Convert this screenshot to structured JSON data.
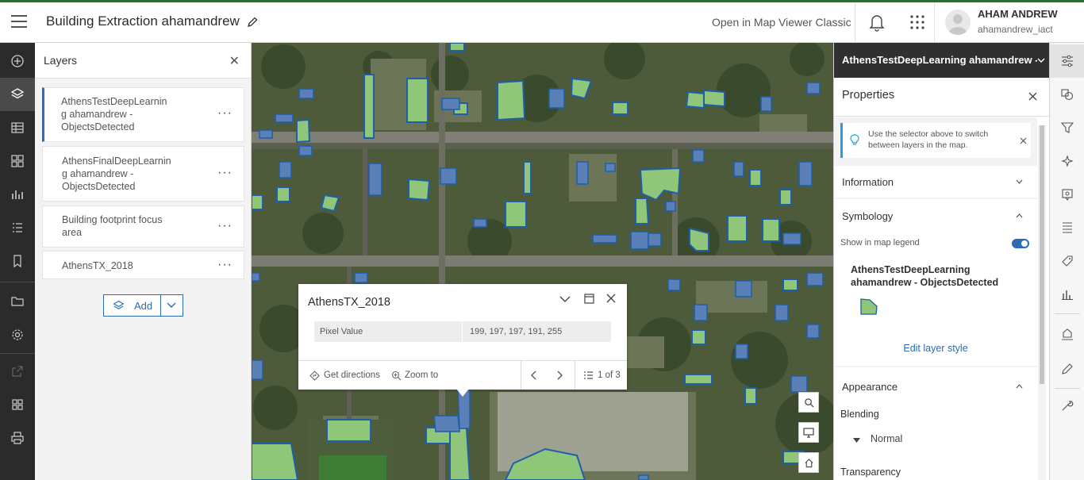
{
  "header": {
    "title": "Building Extraction ahamandrew",
    "classic_link": "Open in Map Viewer Classic",
    "user_name": "AHAM ANDREW",
    "user_id": "ahamandrew_iact"
  },
  "left_toolbar": {
    "icons": [
      "add-icon",
      "layers-icon",
      "table-icon",
      "basemap-icon",
      "charts-icon",
      "legend-icon",
      "bookmark-icon",
      "folder-icon",
      "settings-icon",
      "share-icon",
      "apps-icon",
      "print-icon"
    ]
  },
  "layers_panel": {
    "title": "Layers",
    "layers": [
      {
        "line1": "AthensTestDeepLearnin",
        "line2": "g ahamandrew -",
        "line3": "ObjectsDetected",
        "more": "···"
      },
      {
        "line1": "AthensFinalDeepLearnin",
        "line2": "g ahamandrew -",
        "line3": "ObjectsDetected",
        "more": "···"
      },
      {
        "line1": "Building footprint focus",
        "line2": "area",
        "line3": "",
        "more": "···"
      },
      {
        "line1": "AthensTX_2018",
        "line2": "",
        "line3": "",
        "more": "···"
      }
    ],
    "add_label": "Add"
  },
  "popup": {
    "title": "AthensTX_2018",
    "field_name": "Pixel Value",
    "field_value": "199, 197, 197, 191, 255",
    "directions": "Get directions",
    "zoom": "Zoom to",
    "counter": "1 of 3"
  },
  "properties": {
    "layer_selector": "AthensTestDeepLearning ahamandrew - O",
    "title": "Properties",
    "tip_line1": "Use the selector above to switch",
    "tip_line2": "between layers in the map.",
    "information": "Information",
    "symbology": "Symbology",
    "legend_toggle_label": "Show in map legend",
    "legend_toggle_on": true,
    "symbol_layer_line1": "AthensTestDeepLearning",
    "symbol_layer_line2": "ahamandrew - ObjectsDetected",
    "edit_style": "Edit layer style",
    "appearance": "Appearance",
    "blending": "Blending",
    "blend_mode": "Normal",
    "transparency": "Transparency"
  },
  "colors": {
    "accent": "#2b6cb0",
    "building_fill": "#8fc67a",
    "building_outline": "#1f5ea8",
    "header_bar": "#2e6b35"
  }
}
